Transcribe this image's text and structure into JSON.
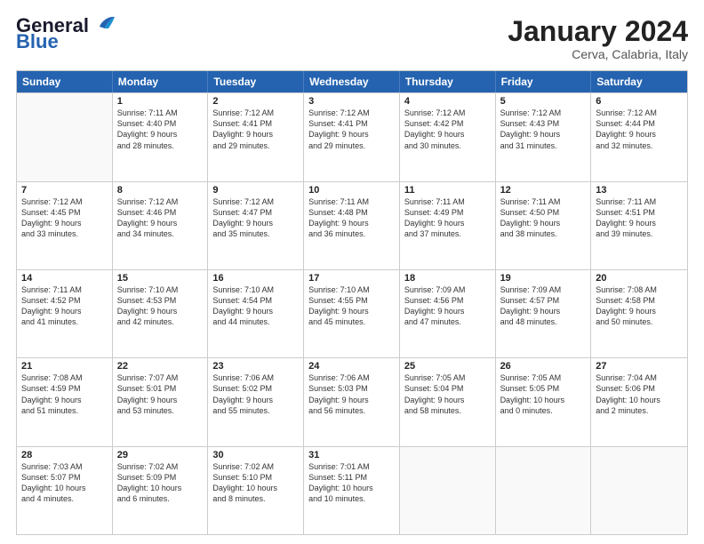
{
  "logo": {
    "text_general": "General",
    "text_blue": "Blue"
  },
  "header": {
    "title": "January 2024",
    "subtitle": "Cerva, Calabria, Italy"
  },
  "weekdays": [
    "Sunday",
    "Monday",
    "Tuesday",
    "Wednesday",
    "Thursday",
    "Friday",
    "Saturday"
  ],
  "rows": [
    [
      {
        "day": "",
        "lines": []
      },
      {
        "day": "1",
        "lines": [
          "Sunrise: 7:11 AM",
          "Sunset: 4:40 PM",
          "Daylight: 9 hours",
          "and 28 minutes."
        ]
      },
      {
        "day": "2",
        "lines": [
          "Sunrise: 7:12 AM",
          "Sunset: 4:41 PM",
          "Daylight: 9 hours",
          "and 29 minutes."
        ]
      },
      {
        "day": "3",
        "lines": [
          "Sunrise: 7:12 AM",
          "Sunset: 4:41 PM",
          "Daylight: 9 hours",
          "and 29 minutes."
        ]
      },
      {
        "day": "4",
        "lines": [
          "Sunrise: 7:12 AM",
          "Sunset: 4:42 PM",
          "Daylight: 9 hours",
          "and 30 minutes."
        ]
      },
      {
        "day": "5",
        "lines": [
          "Sunrise: 7:12 AM",
          "Sunset: 4:43 PM",
          "Daylight: 9 hours",
          "and 31 minutes."
        ]
      },
      {
        "day": "6",
        "lines": [
          "Sunrise: 7:12 AM",
          "Sunset: 4:44 PM",
          "Daylight: 9 hours",
          "and 32 minutes."
        ]
      }
    ],
    [
      {
        "day": "7",
        "lines": [
          "Sunrise: 7:12 AM",
          "Sunset: 4:45 PM",
          "Daylight: 9 hours",
          "and 33 minutes."
        ]
      },
      {
        "day": "8",
        "lines": [
          "Sunrise: 7:12 AM",
          "Sunset: 4:46 PM",
          "Daylight: 9 hours",
          "and 34 minutes."
        ]
      },
      {
        "day": "9",
        "lines": [
          "Sunrise: 7:12 AM",
          "Sunset: 4:47 PM",
          "Daylight: 9 hours",
          "and 35 minutes."
        ]
      },
      {
        "day": "10",
        "lines": [
          "Sunrise: 7:11 AM",
          "Sunset: 4:48 PM",
          "Daylight: 9 hours",
          "and 36 minutes."
        ]
      },
      {
        "day": "11",
        "lines": [
          "Sunrise: 7:11 AM",
          "Sunset: 4:49 PM",
          "Daylight: 9 hours",
          "and 37 minutes."
        ]
      },
      {
        "day": "12",
        "lines": [
          "Sunrise: 7:11 AM",
          "Sunset: 4:50 PM",
          "Daylight: 9 hours",
          "and 38 minutes."
        ]
      },
      {
        "day": "13",
        "lines": [
          "Sunrise: 7:11 AM",
          "Sunset: 4:51 PM",
          "Daylight: 9 hours",
          "and 39 minutes."
        ]
      }
    ],
    [
      {
        "day": "14",
        "lines": [
          "Sunrise: 7:11 AM",
          "Sunset: 4:52 PM",
          "Daylight: 9 hours",
          "and 41 minutes."
        ]
      },
      {
        "day": "15",
        "lines": [
          "Sunrise: 7:10 AM",
          "Sunset: 4:53 PM",
          "Daylight: 9 hours",
          "and 42 minutes."
        ]
      },
      {
        "day": "16",
        "lines": [
          "Sunrise: 7:10 AM",
          "Sunset: 4:54 PM",
          "Daylight: 9 hours",
          "and 44 minutes."
        ]
      },
      {
        "day": "17",
        "lines": [
          "Sunrise: 7:10 AM",
          "Sunset: 4:55 PM",
          "Daylight: 9 hours",
          "and 45 minutes."
        ]
      },
      {
        "day": "18",
        "lines": [
          "Sunrise: 7:09 AM",
          "Sunset: 4:56 PM",
          "Daylight: 9 hours",
          "and 47 minutes."
        ]
      },
      {
        "day": "19",
        "lines": [
          "Sunrise: 7:09 AM",
          "Sunset: 4:57 PM",
          "Daylight: 9 hours",
          "and 48 minutes."
        ]
      },
      {
        "day": "20",
        "lines": [
          "Sunrise: 7:08 AM",
          "Sunset: 4:58 PM",
          "Daylight: 9 hours",
          "and 50 minutes."
        ]
      }
    ],
    [
      {
        "day": "21",
        "lines": [
          "Sunrise: 7:08 AM",
          "Sunset: 4:59 PM",
          "Daylight: 9 hours",
          "and 51 minutes."
        ]
      },
      {
        "day": "22",
        "lines": [
          "Sunrise: 7:07 AM",
          "Sunset: 5:01 PM",
          "Daylight: 9 hours",
          "and 53 minutes."
        ]
      },
      {
        "day": "23",
        "lines": [
          "Sunrise: 7:06 AM",
          "Sunset: 5:02 PM",
          "Daylight: 9 hours",
          "and 55 minutes."
        ]
      },
      {
        "day": "24",
        "lines": [
          "Sunrise: 7:06 AM",
          "Sunset: 5:03 PM",
          "Daylight: 9 hours",
          "and 56 minutes."
        ]
      },
      {
        "day": "25",
        "lines": [
          "Sunrise: 7:05 AM",
          "Sunset: 5:04 PM",
          "Daylight: 9 hours",
          "and 58 minutes."
        ]
      },
      {
        "day": "26",
        "lines": [
          "Sunrise: 7:05 AM",
          "Sunset: 5:05 PM",
          "Daylight: 10 hours",
          "and 0 minutes."
        ]
      },
      {
        "day": "27",
        "lines": [
          "Sunrise: 7:04 AM",
          "Sunset: 5:06 PM",
          "Daylight: 10 hours",
          "and 2 minutes."
        ]
      }
    ],
    [
      {
        "day": "28",
        "lines": [
          "Sunrise: 7:03 AM",
          "Sunset: 5:07 PM",
          "Daylight: 10 hours",
          "and 4 minutes."
        ]
      },
      {
        "day": "29",
        "lines": [
          "Sunrise: 7:02 AM",
          "Sunset: 5:09 PM",
          "Daylight: 10 hours",
          "and 6 minutes."
        ]
      },
      {
        "day": "30",
        "lines": [
          "Sunrise: 7:02 AM",
          "Sunset: 5:10 PM",
          "Daylight: 10 hours",
          "and 8 minutes."
        ]
      },
      {
        "day": "31",
        "lines": [
          "Sunrise: 7:01 AM",
          "Sunset: 5:11 PM",
          "Daylight: 10 hours",
          "and 10 minutes."
        ]
      },
      {
        "day": "",
        "lines": []
      },
      {
        "day": "",
        "lines": []
      },
      {
        "day": "",
        "lines": []
      }
    ]
  ]
}
